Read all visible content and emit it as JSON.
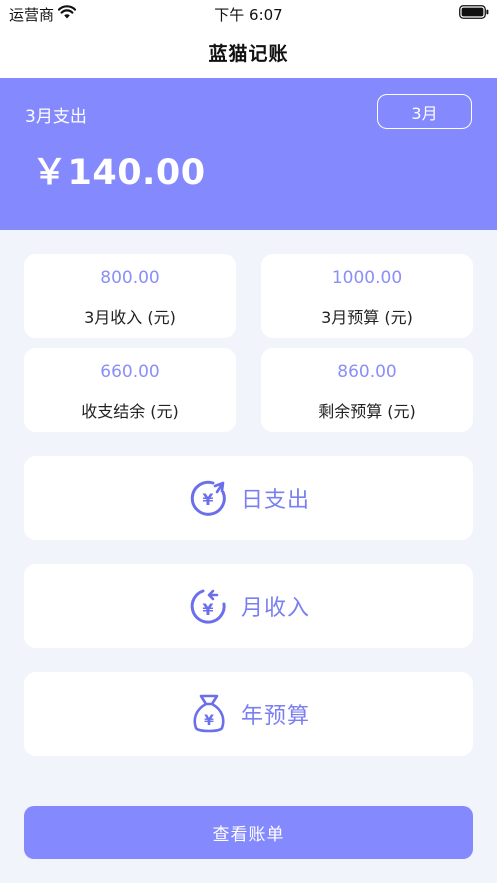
{
  "status_bar": {
    "carrier": "运营商",
    "time": "下午 6:07"
  },
  "nav": {
    "title": "蓝猫记账"
  },
  "summary": {
    "label": "3月支出",
    "month_button": "3月",
    "amount": "￥140.00"
  },
  "stats": [
    {
      "value": "800.00",
      "label": "3月收入 (元)"
    },
    {
      "value": "1000.00",
      "label": "3月预算 (元)"
    },
    {
      "value": "660.00",
      "label": "收支结余 (元)"
    },
    {
      "value": "860.00",
      "label": "剩余预算 (元)"
    }
  ],
  "actions": [
    {
      "label": "日支出",
      "icon": "yen-clock-forward-icon"
    },
    {
      "label": "月收入",
      "icon": "yen-clock-back-icon"
    },
    {
      "label": "年预算",
      "icon": "money-bag-icon"
    }
  ],
  "footer": {
    "view_bill_label": "查看账单"
  },
  "colors": {
    "accent": "#8489fe",
    "value_text": "#8a8ff7",
    "background": "#f2f4fb"
  }
}
